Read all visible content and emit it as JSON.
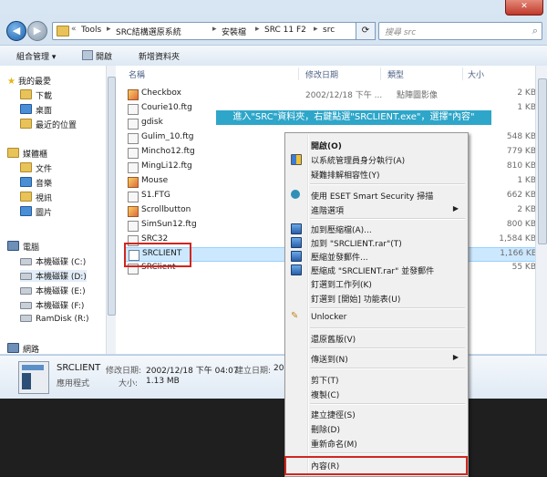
{
  "address": {
    "breadcrumbs": [
      "Tools",
      "SRC結構選原系統",
      "安裝檔",
      "SRC 11 F2",
      "src"
    ],
    "search_placeholder": "搜尋 src",
    "back_icon": "back-arrow-icon",
    "forward_icon": "forward-arrow-icon"
  },
  "window_controls": {
    "close_label": "✕"
  },
  "toolbar": {
    "organize": "組合管理 ▾",
    "open": "開啟",
    "new_folder": "新增資料夾"
  },
  "nav": {
    "favorites": "我的最愛",
    "downloads": "下載",
    "desktop": "桌面",
    "recent": "最近的位置",
    "libraries": "媒體櫃",
    "documents": "文件",
    "music": "音樂",
    "videos": "視訊",
    "pictures": "圖片",
    "computer": "電腦",
    "drive_c": "本機磁碟 (C:)",
    "drive_d": "本機磁碟 (D:)",
    "drive_e": "本機磁碟 (E:)",
    "drive_f": "本機磁碟 (F:)",
    "ramdisk": "RamDisk (R:)",
    "network": "網路"
  },
  "columns": {
    "name": "名稱",
    "date": "修改日期",
    "type": "類型",
    "size": "大小"
  },
  "files": [
    {
      "name": "Checkbox",
      "date": "2002/12/18 下午 ...",
      "type": "點陣圖影像",
      "size": "2 KB",
      "icon": "image"
    },
    {
      "name": "Courie10.ftg",
      "date": "",
      "type": "",
      "size": "1 KB",
      "icon": "file"
    },
    {
      "name": "gdisk",
      "date": "",
      "type": "",
      "size": "",
      "icon": "file"
    },
    {
      "name": "Gulim_10.ftg",
      "date": "",
      "type": "",
      "size": "548 KB",
      "icon": "file"
    },
    {
      "name": "Mincho12.ftg",
      "date": "",
      "type": "",
      "size": "779 KB",
      "icon": "file"
    },
    {
      "name": "MingLi12.ftg",
      "date": "",
      "type": "",
      "size": "810 KB",
      "icon": "file"
    },
    {
      "name": "Mouse",
      "date": "",
      "type": "",
      "size": "1 KB",
      "icon": "image"
    },
    {
      "name": "S1.FTG",
      "date": "",
      "type": "",
      "size": "662 KB",
      "icon": "file"
    },
    {
      "name": "Scrollbutton",
      "date": "",
      "type": "",
      "size": "2 KB",
      "icon": "image"
    },
    {
      "name": "SimSun12.ftg",
      "date": "",
      "type": "",
      "size": "800 KB",
      "icon": "file"
    },
    {
      "name": "SRC32",
      "date": "",
      "type": "",
      "size": "1,584 KB",
      "icon": "file"
    },
    {
      "name": "SRCLIENT",
      "date": "",
      "type": "",
      "size": "1,166 KB",
      "icon": "exe"
    },
    {
      "name": "SRClient",
      "date": "",
      "type": "",
      "size": "55 KB",
      "icon": "file"
    }
  ],
  "details": {
    "name": "SRCLIENT",
    "modified_label": "修改日期:",
    "modified_value": "2002/12/18 下午 04:07",
    "created_label": "建立日期:",
    "created_value": "20",
    "type_value": "應用程式",
    "size_label": "大小:",
    "size_value": "1.13 MB"
  },
  "annotation": "進入\"SRC\"資料夾，右鍵點選\"SRCLIENT.exe\"，選擇\"內容\"",
  "context_menu": {
    "open": "開啟(O)",
    "run_as_admin": "以系統管理員身分執行(A)",
    "troubleshoot": "疑難排解相容性(Y)",
    "eset_scan": "使用 ESET Smart Security 掃描",
    "advanced": "進階選項",
    "add_archive": "加到壓縮檔(A)...",
    "add_rar": "加到 \"SRCLIENT.rar\"(T)",
    "compress_email": "壓縮並發郵件...",
    "compress_rar_email": "壓縮成 \"SRCLIENT.rar\" 並發郵件",
    "pin_taskbar": "釘選到工作列(K)",
    "pin_start": "釘選到 [開始] 功能表(U)",
    "unlocker": "Unlocker",
    "restore": "還原舊版(V)",
    "send_to": "傳送到(N)",
    "cut": "剪下(T)",
    "copy": "複製(C)",
    "create_shortcut": "建立捷徑(S)",
    "delete": "刪除(D)",
    "rename": "重新命名(M)",
    "properties": "內容(R)"
  },
  "colors": {
    "highlight_box": "#d0271f",
    "annotation_bg": "#2ea6c9",
    "selection_bg": "#cce8ff"
  }
}
